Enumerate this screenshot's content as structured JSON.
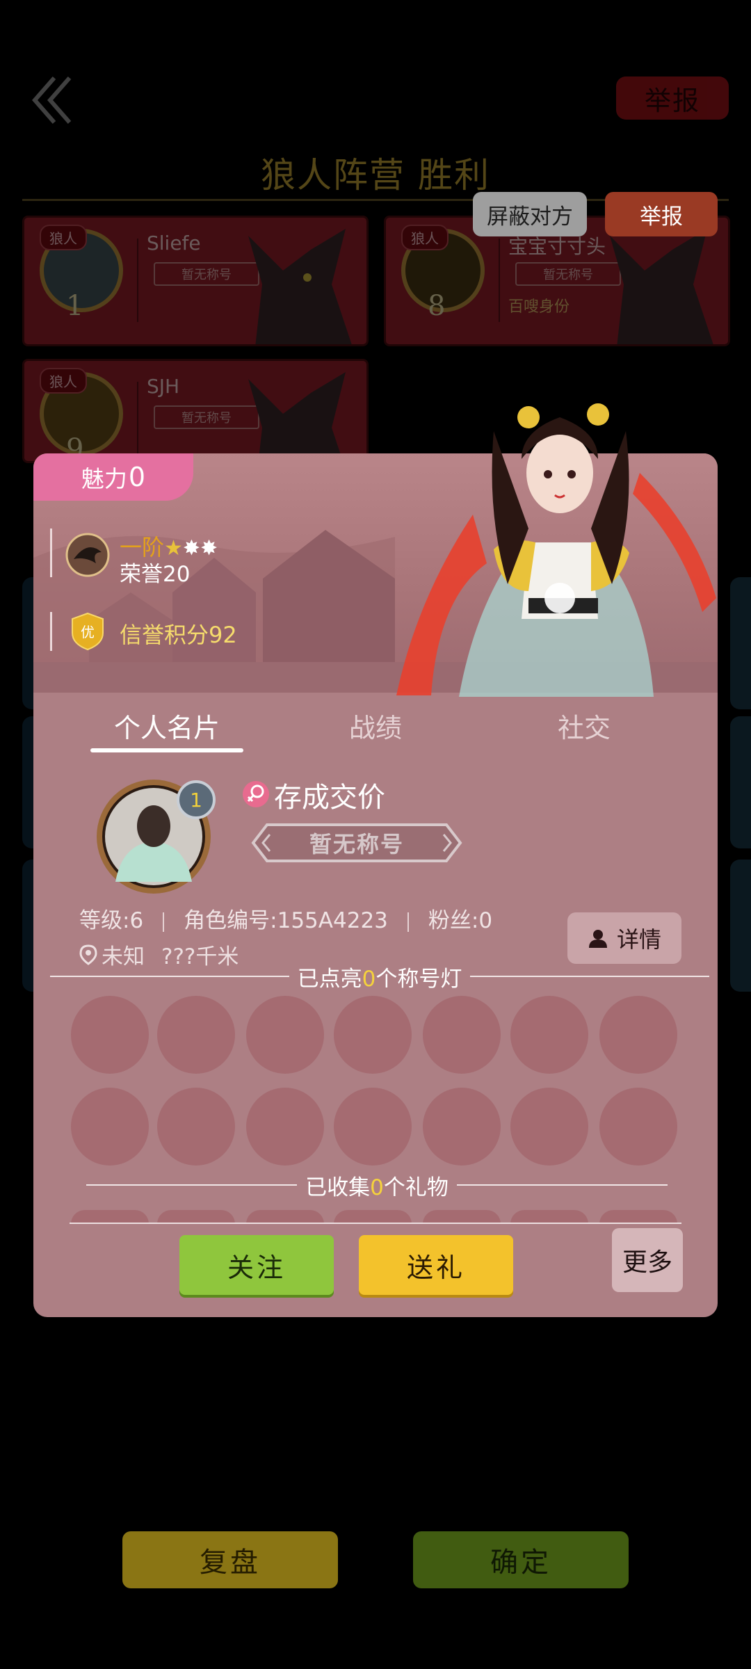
{
  "background": {
    "report_top": "举报",
    "title": "狼人阵营  胜利",
    "players": [
      {
        "badge": "狼人",
        "seat": "1",
        "name": "Sliefe",
        "title": "暂无称号",
        "extra": ""
      },
      {
        "badge": "狼人",
        "seat": "8",
        "name": "宝宝寸寸头",
        "title": "暂无称号",
        "extra": "百嗖身份"
      },
      {
        "badge": "狼人",
        "seat": "9",
        "name": "SJH",
        "title": "暂无称号",
        "extra": ""
      }
    ],
    "block_button": "屏蔽对方",
    "report_button": "举报",
    "replay_button": "复盘",
    "confirm_button": "确定"
  },
  "profile": {
    "charm_label": "魅力",
    "charm_value": "0",
    "rank_label": "一阶",
    "honor": "荣誉20",
    "credit": "信誉积分92",
    "credit_badge": "优",
    "tabs": [
      "个人名片",
      "战绩",
      "社交"
    ],
    "active_tab": 0,
    "level_badge": "1",
    "nickname": "存成交价",
    "title_plate": "暂无称号",
    "level": "等级:6",
    "role_id": "角色编号:155A4223",
    "fans": "粉丝:0",
    "location": "未知",
    "distance": "???千米",
    "detail_button": "详情",
    "lamps_prefix": "已点亮",
    "lamps_count": "0",
    "lamps_suffix": "个称号灯",
    "gifts_prefix": "已收集",
    "gifts_count": "0",
    "gifts_suffix": "个礼物",
    "follow_button": "关注",
    "gift_button": "送礼",
    "more_button": "更多"
  },
  "colors": {
    "popup_bg": "#ad7f84",
    "charm_pink": "#e470a0",
    "follow_green": "#8fc63d",
    "gift_yellow": "#f3c22c",
    "highlight_yellow": "#f5d23c"
  }
}
